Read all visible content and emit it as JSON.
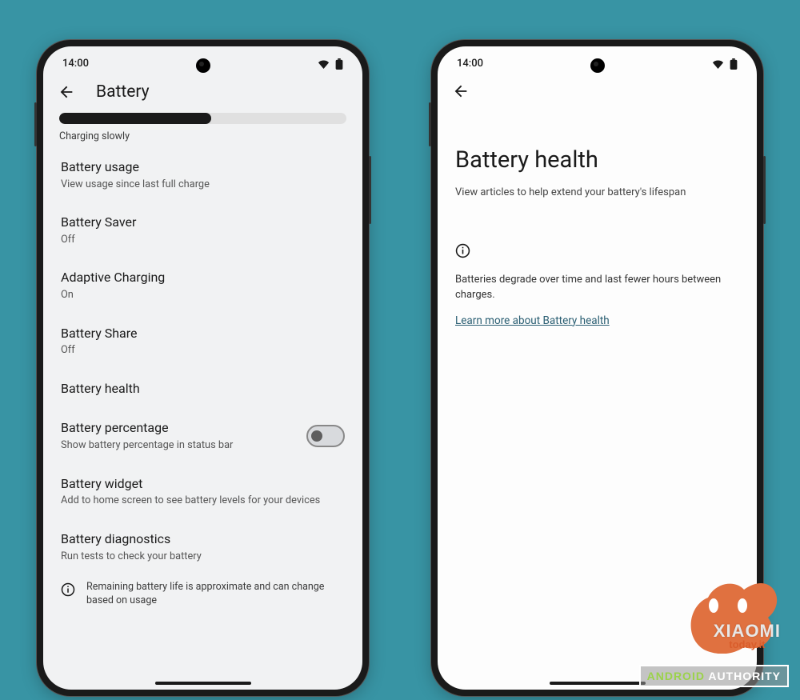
{
  "status": {
    "time": "14:00"
  },
  "phone1": {
    "title": "Battery",
    "charging_status": "Charging slowly",
    "items": {
      "usage": {
        "title": "Battery usage",
        "sub": "View usage since last full charge"
      },
      "saver": {
        "title": "Battery Saver",
        "sub": "Off"
      },
      "adaptive": {
        "title": "Adaptive Charging",
        "sub": "On"
      },
      "share": {
        "title": "Battery Share",
        "sub": "Off"
      },
      "health": {
        "title": "Battery health"
      },
      "percentage": {
        "title": "Battery percentage",
        "sub": "Show battery percentage in status bar"
      },
      "widget": {
        "title": "Battery widget",
        "sub": "Add to home screen to see battery levels for your devices"
      },
      "diag": {
        "title": "Battery diagnostics",
        "sub": "Run tests to check your battery"
      }
    },
    "footer": "Remaining battery life is approximate and can change based on usage"
  },
  "phone2": {
    "title": "Battery health",
    "subtitle": "View articles to help extend your battery's lifespan",
    "info_text": "Batteries degrade over time and last fewer hours between charges.",
    "link_text": "Learn more about Battery health"
  },
  "watermark": {
    "xiaomi": "XIAOMI",
    "today": "today.it",
    "android": "ANDROID",
    "authority": "AUTHORITY"
  }
}
